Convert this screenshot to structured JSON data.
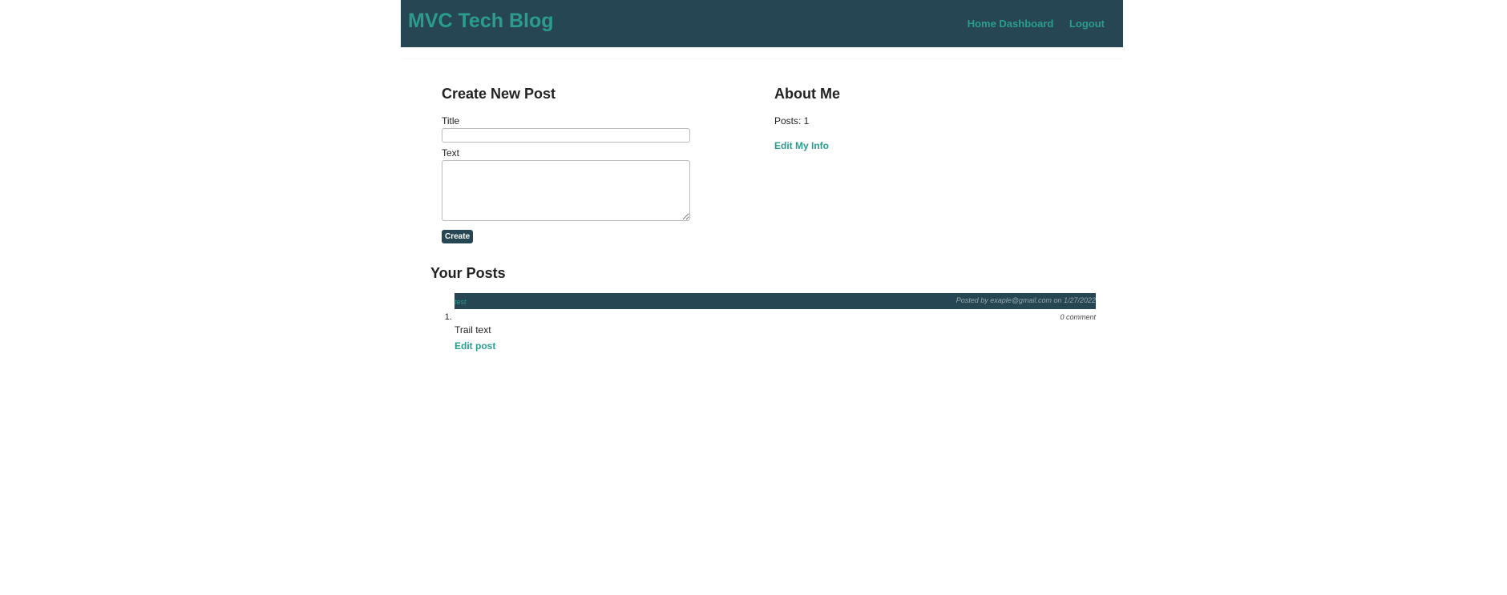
{
  "header": {
    "title": "MVC Tech Blog",
    "nav": {
      "home_dashboard": "Home Dashboard",
      "logout": "Logout"
    }
  },
  "create_post": {
    "heading": "Create New Post",
    "title_label": "Title",
    "title_value": "",
    "text_label": "Text",
    "text_value": "",
    "button_label": "Create"
  },
  "about": {
    "heading": "About Me",
    "posts_count": "Posts: 1",
    "edit_link": "Edit My Info"
  },
  "your_posts": {
    "heading": "Your Posts",
    "items": [
      {
        "title": "test",
        "meta": "Posted by exaple@gmail.com on 1/27/2022",
        "comments": "0 comment",
        "body": "Trail text",
        "edit_link": "Edit post"
      }
    ]
  },
  "colors": {
    "header_bg": "#264653",
    "accent": "#2a9d8f"
  }
}
